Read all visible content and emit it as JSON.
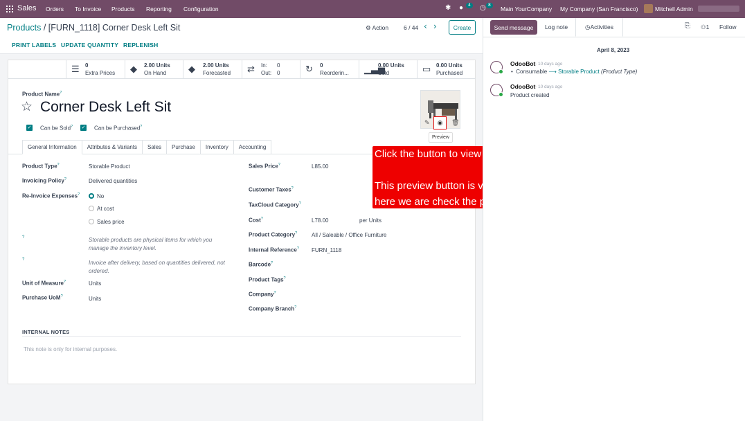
{
  "topbar": {
    "app": "Sales",
    "menu": [
      "Orders",
      "To Invoice",
      "Products",
      "Reporting",
      "Configuration"
    ],
    "messages_count": "4",
    "activities_count": "8",
    "main_company": "Main YourCompany",
    "company": "My Company (San Francisco)",
    "user": "Mitchell Admin"
  },
  "breadcrumb": {
    "parent": "Products",
    "current": "[FURN_1118] Corner Desk Left Sit"
  },
  "control": {
    "action": "Action",
    "pager": "6 / 44",
    "create": "Create"
  },
  "buttons": {
    "print_labels": "PRINT LABELS",
    "update_quantity": "UPDATE QUANTITY",
    "replenish": "REPLENISH"
  },
  "stats": [
    {
      "value": "0",
      "label": "Extra Prices",
      "icon": "list-icon"
    },
    {
      "value": "2.00 Units",
      "label": "On Hand",
      "icon": "cubes-icon"
    },
    {
      "value": "2.00 Units",
      "label": "Forecasted",
      "icon": "cubes-icon"
    },
    {
      "in_label": "In:",
      "in_value": "0",
      "out_label": "Out:",
      "out_value": "0",
      "icon": "exchange-icon"
    },
    {
      "value": "0",
      "label": "Reorderin...",
      "icon": "refresh-icon"
    },
    {
      "value": "0.00 Units",
      "label": "Sold",
      "icon": "signal-icon"
    },
    {
      "value": "0.00 Units",
      "label": "Purchased",
      "icon": "credit-card-icon"
    }
  ],
  "product": {
    "name_label": "Product Name",
    "name": "Corner Desk Left Sit",
    "can_be_sold": "Can be Sold",
    "can_be_purchased": "Can be Purchased"
  },
  "image": {
    "tooltip": "Preview"
  },
  "tabs": [
    "General Information",
    "Attributes & Variants",
    "Sales",
    "Purchase",
    "Inventory",
    "Accounting"
  ],
  "left_fields": {
    "product_type_label": "Product Type",
    "product_type": "Storable Product",
    "invoicing_policy_label": "Invoicing Policy",
    "invoicing_policy": "Delivered quantities",
    "reinvoice_label": "Re-Invoice Expenses",
    "reinvoice_options": [
      "No",
      "At cost",
      "Sales price"
    ],
    "help1_line1": "Storable products are physical items for which you",
    "help1_line2": "manage the inventory level.",
    "help2_line1": "Invoice after delivery, based on quantities delivered, not",
    "help2_line2": "ordered.",
    "uom_label": "Unit of Measure",
    "uom": "Units",
    "purchase_uom_label": "Purchase UoM",
    "purchase_uom": "Units"
  },
  "right_fields": {
    "sales_price_label": "Sales Price",
    "sales_price": "L85.00",
    "customer_taxes_label": "Customer Taxes",
    "taxcloud_label": "TaxCloud Category",
    "cost_label": "Cost",
    "cost": "L78.00",
    "cost_unit": "per Units",
    "category_label": "Product Category",
    "category": "All / Saleable / Office Furniture",
    "internal_ref_label": "Internal Reference",
    "internal_ref": "FURN_1118",
    "barcode_label": "Barcode",
    "tags_label": "Product Tags",
    "company_label": "Company",
    "branch_label": "Company Branch"
  },
  "notes": {
    "label": "INTERNAL NOTES",
    "placeholder": "This note is only for internal purposes."
  },
  "callout": {
    "line1": "Click the button to view the image,",
    "line2": "This preview button is visible on every image widget",
    "line3": "here we are check the product image"
  },
  "chatter": {
    "send_message": "Send message",
    "log_note": "Log note",
    "activities": "Activities",
    "followers_count": "1",
    "follow": "Follow",
    "date": "April 8, 2023",
    "messages": [
      {
        "author": "OdooBot",
        "time": "- 10 days ago",
        "old": "Consumable",
        "new": "Storable Product",
        "field": "(Product Type)"
      },
      {
        "author": "OdooBot",
        "time": "- 10 days ago",
        "body": "Product created"
      }
    ]
  }
}
